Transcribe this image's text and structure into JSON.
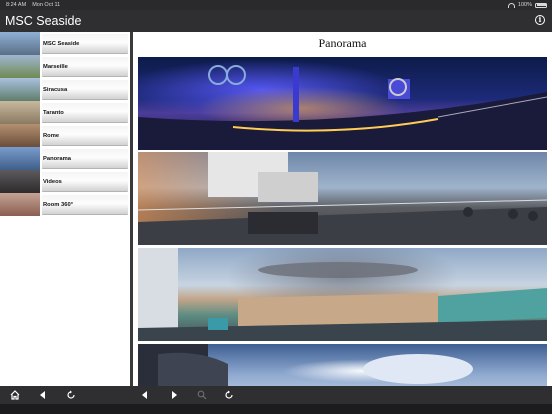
{
  "status_bar": {
    "time": "8:24 AM",
    "date": "Mon Oct 11",
    "battery": "100%"
  },
  "header": {
    "title": "MSC Seaside"
  },
  "sidebar": {
    "items": [
      {
        "label": "MSC Seaside",
        "thumb_color": "#6d8fb8"
      },
      {
        "label": "Marseille",
        "thumb_color": "#8aa06a"
      },
      {
        "label": "Siracusa",
        "thumb_color": "#9eb6d6"
      },
      {
        "label": "Taranto",
        "thumb_color": "#b7a58a"
      },
      {
        "label": "Rome",
        "thumb_color": "#a47a5a"
      },
      {
        "label": "Panorama",
        "thumb_color": "#5c7fae"
      },
      {
        "label": "Videos",
        "thumb_color": "#4a4646"
      },
      {
        "label": "Room 360°",
        "thumb_color": "#a87a6e"
      }
    ]
  },
  "content": {
    "title": "Panorama",
    "images": [
      "panorama-night-deck",
      "panorama-pool-deck-sunset",
      "panorama-city-harbor",
      "panorama-ship-sky"
    ]
  },
  "toolbar": {
    "icons": [
      "home-icon",
      "back-icon",
      "refresh-icon",
      "back-icon",
      "forward-icon",
      "zoom-icon",
      "refresh-icon"
    ]
  }
}
